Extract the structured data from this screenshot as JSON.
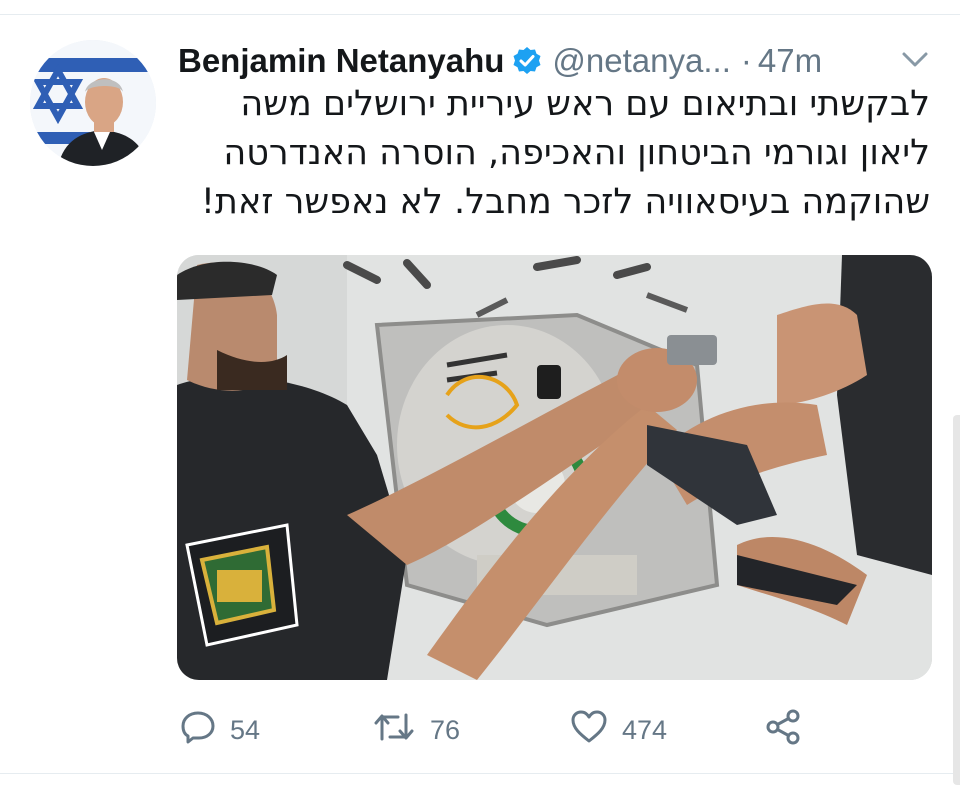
{
  "tweet": {
    "author_name": "Benjamin Netanyahu",
    "handle": "@netanya...",
    "separator": "·",
    "time": "47m",
    "text_lines": [
      "לבקשתי ובתיאום עם ראש עיריית ירושלים משה",
      "ליאון וגורמי הביטחון והאכיפה, הוסרה האנדרטה",
      "שהוקמה בעיסאוויה לזכר מחבל. לא נאפשר זאת!"
    ]
  },
  "actions": {
    "reply_count": "54",
    "retweet_count": "76",
    "like_count": "474"
  },
  "icons": {
    "verified": "verified-badge-icon",
    "menu": "chevron-down-icon",
    "reply": "reply-icon",
    "retweet": "retweet-icon",
    "like": "heart-icon",
    "share": "share-icon"
  },
  "colors": {
    "verified_blue": "#1da1f2",
    "secondary_text": "#657786",
    "primary_text": "#14171a"
  }
}
